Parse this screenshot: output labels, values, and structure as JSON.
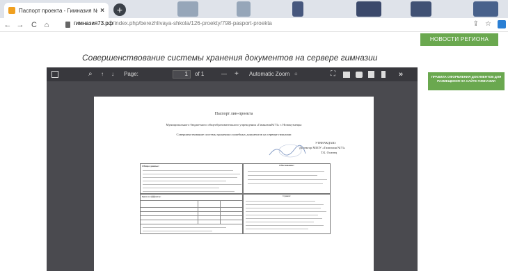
{
  "browser": {
    "tab_title": "Паспорт проекта - Гимназия №",
    "tab_close": "×",
    "new_tab": "+",
    "back": "←",
    "forward": "→",
    "reload": "C",
    "home": "⌂",
    "url_domain": "гимназия73.рф",
    "url_path": "/index.php/berezhlivaya-shkola/126-proekty/798-pasport-proekta",
    "share_icon": "⇪",
    "star_icon": "☆"
  },
  "site": {
    "page_title": "Совершенствование системы хранения документов на сервере гимназии",
    "news_button": "НОВОСТИ РЕГИОНА",
    "rules_banner": "ПРАВИЛА ОФОРМЛЕНИЯ ДОКУМЕНТОВ ДЛЯ РАЗМЕЩЕНИЯ НА САЙТЕ ГИМНАЗИИ"
  },
  "pdf_viewer": {
    "page_label": "Page:",
    "page_number": "1",
    "page_count": "of 1",
    "zoom_out": "—",
    "zoom_in": "+",
    "zoom_value": "Automatic Zoom",
    "more": "»"
  },
  "document": {
    "title": "Паспорт лин-проекта",
    "org": "Муниципального бюджетного общеобразовательного учреждения «Гимназия№73» г. Новокузнецка",
    "topic": "Совершенствование системы хранения служебных документов на сервере гимназии",
    "approve_1": "УТВЕРЖДАЮ:",
    "approve_2": "Директор МБОУ «Гимназия №73»",
    "approve_3": "Т.К. Осинец",
    "left_block_heading": "Общие данные:",
    "right_block_heading": "Обоснование:",
    "goals_heading": "Цели и эффекты:",
    "timeline_heading": "Сроки:"
  }
}
